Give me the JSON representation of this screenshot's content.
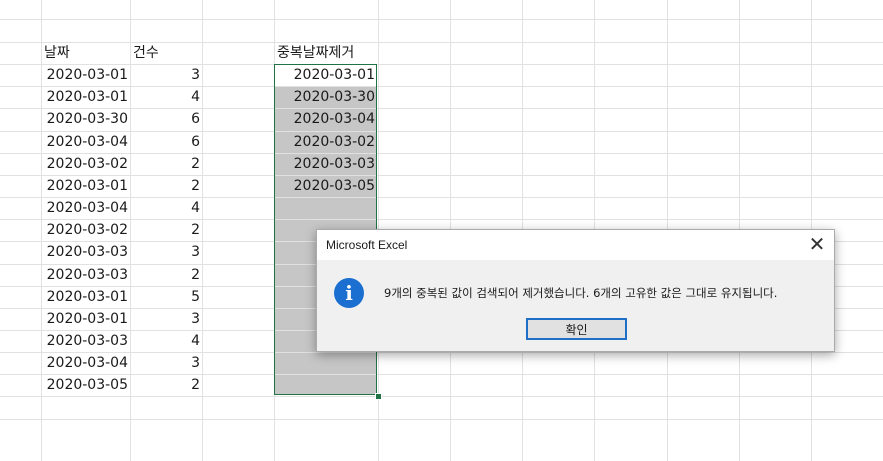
{
  "sheet": {
    "headers": {
      "date": "날짜",
      "count": "건수",
      "dedup": "중복날짜제거"
    },
    "rows": [
      {
        "date": "2020-03-01",
        "count": "3"
      },
      {
        "date": "2020-03-01",
        "count": "4"
      },
      {
        "date": "2020-03-30",
        "count": "6"
      },
      {
        "date": "2020-03-04",
        "count": "6"
      },
      {
        "date": "2020-03-02",
        "count": "2"
      },
      {
        "date": "2020-03-01",
        "count": "2"
      },
      {
        "date": "2020-03-04",
        "count": "4"
      },
      {
        "date": "2020-03-02",
        "count": "2"
      },
      {
        "date": "2020-03-03",
        "count": "3"
      },
      {
        "date": "2020-03-03",
        "count": "2"
      },
      {
        "date": "2020-03-01",
        "count": "5"
      },
      {
        "date": "2020-03-01",
        "count": "3"
      },
      {
        "date": "2020-03-03",
        "count": "4"
      },
      {
        "date": "2020-03-04",
        "count": "3"
      },
      {
        "date": "2020-03-05",
        "count": "2"
      }
    ],
    "unique_dates": [
      "2020-03-01",
      "2020-03-30",
      "2020-03-04",
      "2020-03-02",
      "2020-03-03",
      "2020-03-05"
    ],
    "selection_color": "#217346",
    "selection_fill": "#c6c6c6"
  },
  "dialog": {
    "title": "Microsoft Excel",
    "close_icon": "close-icon",
    "icon": "info-icon",
    "icon_glyph": "i",
    "message": "9개의 중복된 값이 검색되어 제거했습니다. 6개의 고유한 값은 그대로 유지됩니다.",
    "ok_label": "확인",
    "accent_color": "#1a6fd0"
  }
}
